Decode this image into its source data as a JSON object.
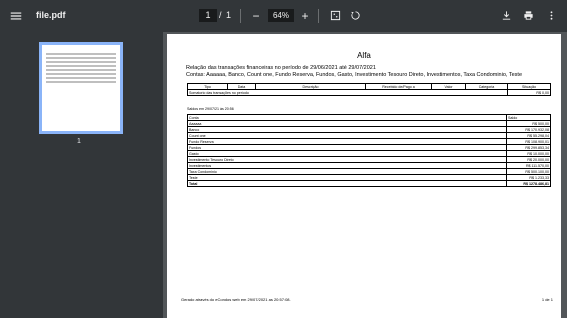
{
  "toolbar": {
    "file_name": "file.pdf",
    "current_page": "1",
    "page_separator": "/",
    "total_pages": "1",
    "zoom_out": "−",
    "zoom_level": "64%",
    "zoom_in": "+"
  },
  "sidebar": {
    "thumbnail_page_number": "1"
  },
  "document": {
    "title": "Alfa",
    "period_line": "Relação das transações financeiras no período de 29/06/2021 até 29/07/2021",
    "accounts_line": "Contas: Aaaaaa, Banco, Count one, Fundo Reserva, Fundos, Gasto, Investimento Tesouro Direto, Investimentos, Taxa Condominio, Teste",
    "transactions_table": {
      "headers": [
        "Tipo",
        "Data",
        "Descrição",
        "Recebido de/Pago a",
        "Valor",
        "Categoria",
        "Situação"
      ],
      "summary_label": "Somatorio das transações no período",
      "summary_value": "R$ 0,00"
    },
    "saldos_label": "Saldos em 29/07/21 às 20:56",
    "balances_table": {
      "headers": [
        "Conta",
        "Saldo"
      ],
      "rows": [
        {
          "conta": "Aaaaaa",
          "saldo": "R$ 500,00"
        },
        {
          "conta": "Banco",
          "saldo": "R$ 170.932,08"
        },
        {
          "conta": "Count one",
          "saldo": "R$ 55.298,04"
        },
        {
          "conta": "Fundo Reserva",
          "saldo": "R$ 108.900,01"
        },
        {
          "conta": "Fundos",
          "saldo": "R$ 299.853,34"
        },
        {
          "conta": "Gasto",
          "saldo": "R$ 10.000,00"
        },
        {
          "conta": "Investimento Tesouro Direto",
          "saldo": "R$ 20.000,00"
        },
        {
          "conta": "Investimentos",
          "saldo": "R$ 111.570,00"
        },
        {
          "conta": "Taxa Condominio",
          "saldo": "R$ 500.100,00"
        },
        {
          "conta": "Teste",
          "saldo": "R$ 1.233,33"
        }
      ],
      "total_label": "Total",
      "total_value": "R$ 1278.486,81"
    },
    "footer_left": "Gerado através do eCondos web em 29/07/2021 as 20:57:08.",
    "footer_right": "1 de 1"
  }
}
